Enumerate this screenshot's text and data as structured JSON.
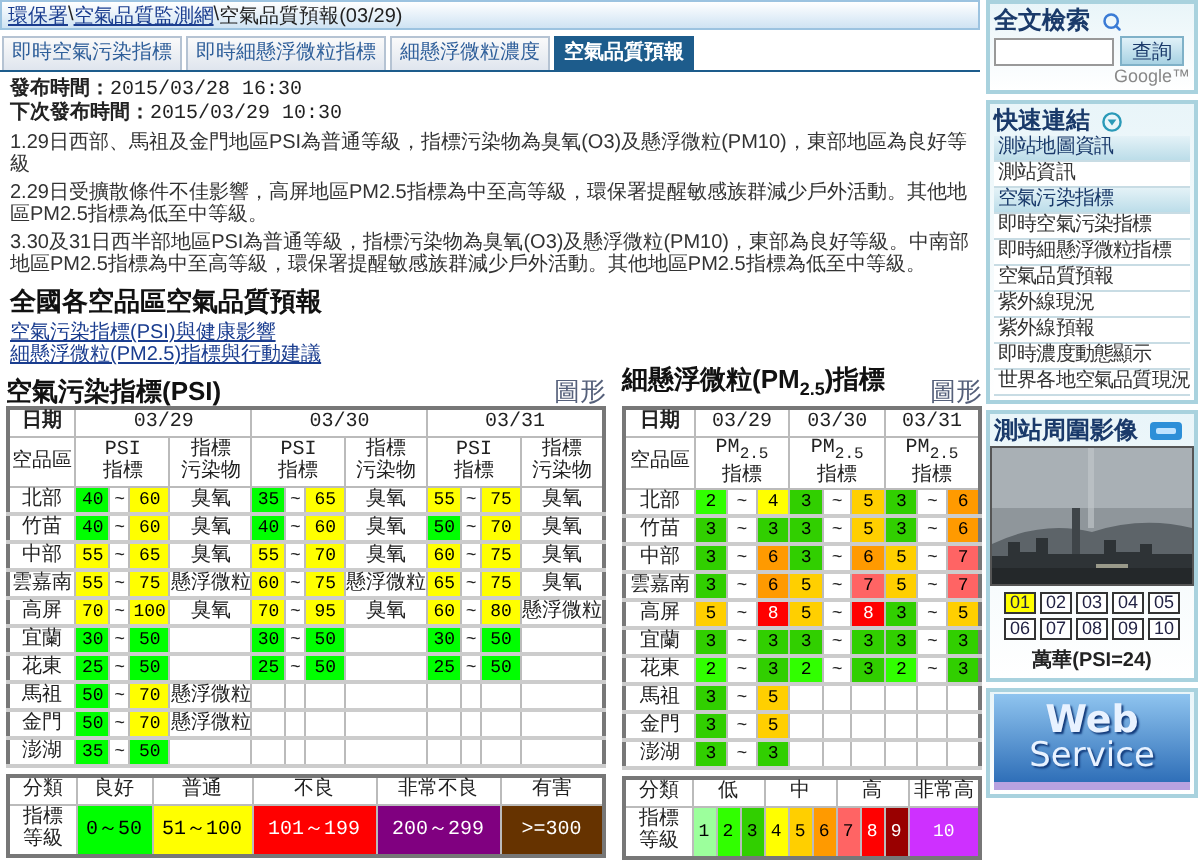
{
  "breadcrumb": [
    {
      "text": "環保署",
      "kind": "link"
    },
    {
      "text": "\\",
      "kind": "sep"
    },
    {
      "text": "空氣品質監測網",
      "kind": "link"
    },
    {
      "text": "\\",
      "kind": "sep"
    },
    {
      "text": "空氣品質預報(03/29)",
      "kind": "current"
    }
  ],
  "tabs": [
    {
      "label": "即時空氣污染指標",
      "selected": false
    },
    {
      "label": "即時細懸浮微粒指標",
      "selected": false
    },
    {
      "label": "細懸浮微粒濃度",
      "selected": false
    },
    {
      "label": "空氣品質預報",
      "selected": true
    }
  ],
  "release": [
    "**發布時間：**2015/03/28 16:30",
    "**下次發布時間：**2015/03/29 10:30"
  ],
  "paragraphs": [
    "1.29日西部、馬祖及金門地區PSI為普通等級，指標污染物為臭氧(O3)及懸浮微粒(PM10)，東部地區為良好等級",
    "2.29日受擴散條件不佳影響，高屏地區PM2.5指標為中至高等級，環保署提醒敏感族群減少戶外活動。其他地區PM2.5指標為低至中等級。",
    "3.30及31日西半部地區PSI為普通等級，指標污染物為臭氧(O3)及懸浮微粒(PM10)，東部為良好等級。中南部地區PM2.5指標為中至高等級，環保署提醒敏感族群減少戶外活動。其他地區PM2.5指標為低至中等級。"
  ],
  "heading": "全國各空品區空氣品質預報",
  "links": [
    "空氣污染指標(PSI)與健康影響",
    "細懸浮微粒(PM2.5)指標與行動建議"
  ],
  "psi": {
    "title": "空氣污染指標(PSI)",
    "graph_link": "圖形",
    "date_label": "日期",
    "area_label": "空品區",
    "days": [
      {
        "date": "03/29",
        "index_label": [
          "PSI",
          "指標"
        ],
        "pollutant_label": [
          "指標",
          "污染物"
        ]
      },
      {
        "date": "03/30",
        "index_label": [
          "PSI",
          "指標"
        ],
        "pollutant_label": [
          "指標",
          "污染物"
        ]
      },
      {
        "date": "03/31",
        "index_label": [
          "PSI",
          "指標"
        ],
        "pollutant_label": [
          "指標",
          "污染物"
        ]
      }
    ],
    "rows": [
      {
        "area": "北部",
        "days": [
          {
            "low": {
              "v": "40",
              "color": "#00ff00"
            },
            "tilde": "~",
            "high": {
              "v": "60",
              "color": "#ffff00"
            },
            "pollutant": "臭氧"
          },
          {
            "low": {
              "v": "35",
              "color": "#00ff00"
            },
            "tilde": "~",
            "high": {
              "v": "65",
              "color": "#ffff00"
            },
            "pollutant": "臭氧"
          },
          {
            "low": {
              "v": "55",
              "color": "#ffff00"
            },
            "tilde": "~",
            "high": {
              "v": "75",
              "color": "#ffff00"
            },
            "pollutant": "臭氧"
          }
        ]
      },
      {
        "area": "竹苗",
        "days": [
          {
            "low": {
              "v": "40",
              "color": "#00ff00"
            },
            "tilde": "~",
            "high": {
              "v": "60",
              "color": "#ffff00"
            },
            "pollutant": "臭氧"
          },
          {
            "low": {
              "v": "40",
              "color": "#00ff00"
            },
            "tilde": "~",
            "high": {
              "v": "60",
              "color": "#ffff00"
            },
            "pollutant": "臭氧"
          },
          {
            "low": {
              "v": "50",
              "color": "#00ff00"
            },
            "tilde": "~",
            "high": {
              "v": "70",
              "color": "#ffff00"
            },
            "pollutant": "臭氧"
          }
        ]
      },
      {
        "area": "中部",
        "days": [
          {
            "low": {
              "v": "55",
              "color": "#ffff00"
            },
            "tilde": "~",
            "high": {
              "v": "65",
              "color": "#ffff00"
            },
            "pollutant": "臭氧"
          },
          {
            "low": {
              "v": "55",
              "color": "#ffff00"
            },
            "tilde": "~",
            "high": {
              "v": "70",
              "color": "#ffff00"
            },
            "pollutant": "臭氧"
          },
          {
            "low": {
              "v": "60",
              "color": "#ffff00"
            },
            "tilde": "~",
            "high": {
              "v": "75",
              "color": "#ffff00"
            },
            "pollutant": "臭氧"
          }
        ]
      },
      {
        "area": "雲嘉南",
        "days": [
          {
            "low": {
              "v": "55",
              "color": "#ffff00"
            },
            "tilde": "~",
            "high": {
              "v": "75",
              "color": "#ffff00"
            },
            "pollutant": "懸浮微粒"
          },
          {
            "low": {
              "v": "60",
              "color": "#ffff00"
            },
            "tilde": "~",
            "high": {
              "v": "75",
              "color": "#ffff00"
            },
            "pollutant": "懸浮微粒"
          },
          {
            "low": {
              "v": "65",
              "color": "#ffff00"
            },
            "tilde": "~",
            "high": {
              "v": "75",
              "color": "#ffff00"
            },
            "pollutant": "臭氧"
          }
        ]
      },
      {
        "area": "高屏",
        "days": [
          {
            "low": {
              "v": "70",
              "color": "#ffff00"
            },
            "tilde": "~",
            "high": {
              "v": "100",
              "color": "#ffff00"
            },
            "pollutant": "臭氧"
          },
          {
            "low": {
              "v": "70",
              "color": "#ffff00"
            },
            "tilde": "~",
            "high": {
              "v": "95",
              "color": "#ffff00"
            },
            "pollutant": "臭氧"
          },
          {
            "low": {
              "v": "60",
              "color": "#ffff00"
            },
            "tilde": "~",
            "high": {
              "v": "80",
              "color": "#ffff00"
            },
            "pollutant": "懸浮微粒"
          }
        ]
      },
      {
        "area": "宜蘭",
        "days": [
          {
            "low": {
              "v": "30",
              "color": "#00ff00"
            },
            "tilde": "~",
            "high": {
              "v": "50",
              "color": "#00ff00"
            }
          },
          {
            "low": {
              "v": "30",
              "color": "#00ff00"
            },
            "tilde": "~",
            "high": {
              "v": "50",
              "color": "#00ff00"
            }
          },
          {
            "low": {
              "v": "30",
              "color": "#00ff00"
            },
            "tilde": "~",
            "high": {
              "v": "50",
              "color": "#00ff00"
            }
          }
        ]
      },
      {
        "area": "花東",
        "days": [
          {
            "low": {
              "v": "25",
              "color": "#00ff00"
            },
            "tilde": "~",
            "high": {
              "v": "50",
              "color": "#00ff00"
            }
          },
          {
            "low": {
              "v": "25",
              "color": "#00ff00"
            },
            "tilde": "~",
            "high": {
              "v": "50",
              "color": "#00ff00"
            }
          },
          {
            "low": {
              "v": "25",
              "color": "#00ff00"
            },
            "tilde": "~",
            "high": {
              "v": "50",
              "color": "#00ff00"
            }
          }
        ]
      },
      {
        "area": "馬祖",
        "days": [
          {
            "low": {
              "v": "50",
              "color": "#00ff00"
            },
            "tilde": "~",
            "high": {
              "v": "70",
              "color": "#ffff00"
            },
            "pollutant": "懸浮微粒"
          }
        ]
      },
      {
        "area": "金門",
        "days": [
          {
            "low": {
              "v": "50",
              "color": "#00ff00"
            },
            "tilde": "~",
            "high": {
              "v": "70",
              "color": "#ffff00"
            },
            "pollutant": "懸浮微粒"
          }
        ]
      },
      {
        "area": "澎湖",
        "days": [
          {
            "low": {
              "v": "35",
              "color": "#00ff00"
            },
            "tilde": "~",
            "high": {
              "v": "50",
              "color": "#00ff00"
            }
          }
        ]
      }
    ],
    "legend": {
      "category_label": "分類",
      "level_label": [
        "指標",
        "等級"
      ],
      "categories": [
        {
          "name": "良好",
          "range": "0～50",
          "color": "#00ff00"
        },
        {
          "name": "普通",
          "range": "51～100",
          "color": "#ffff00"
        },
        {
          "name": "不良",
          "range": "101～199",
          "color": "#ff0000"
        },
        {
          "name": "非常不良",
          "range": "200～299",
          "color": "#800080"
        },
        {
          "name": "有害",
          "range": ">=300",
          "color": "#663300"
        }
      ]
    }
  },
  "pm25": {
    "title": "細懸浮微粒(PM$_{2.5}$)指標",
    "graph_link": "圖形",
    "date_label": "日期",
    "area_label": "空品區",
    "days": [
      {
        "date": "03/29",
        "index_label": [
          "PM$_{2.5}$",
          "指標"
        ]
      },
      {
        "date": "03/30",
        "index_label": [
          "PM$_{2.5}$",
          "指標"
        ]
      },
      {
        "date": "03/31",
        "index_label": [
          "PM$_{2.5}$",
          "指標"
        ]
      }
    ],
    "rows": [
      {
        "area": "北部",
        "days": [
          {
            "low": {
              "v": "2",
              "color": "#31ff00"
            },
            "tilde": "~",
            "high": {
              "v": "4",
              "color": "#ffff00"
            }
          },
          {
            "low": {
              "v": "3",
              "color": "#31cf00"
            },
            "tilde": "~",
            "high": {
              "v": "5",
              "color": "#ffcf00"
            }
          },
          {
            "low": {
              "v": "3",
              "color": "#31cf00"
            },
            "tilde": "~",
            "high": {
              "v": "6",
              "color": "#ff9a00"
            }
          }
        ]
      },
      {
        "area": "竹苗",
        "days": [
          {
            "low": {
              "v": "3",
              "color": "#31cf00"
            },
            "tilde": "~",
            "high": {
              "v": "3",
              "color": "#31cf00"
            }
          },
          {
            "low": {
              "v": "3",
              "color": "#31cf00"
            },
            "tilde": "~",
            "high": {
              "v": "5",
              "color": "#ffcf00"
            }
          },
          {
            "low": {
              "v": "3",
              "color": "#31cf00"
            },
            "tilde": "~",
            "high": {
              "v": "6",
              "color": "#ff9a00"
            }
          }
        ]
      },
      {
        "area": "中部",
        "days": [
          {
            "low": {
              "v": "3",
              "color": "#31cf00"
            },
            "tilde": "~",
            "high": {
              "v": "6",
              "color": "#ff9a00"
            }
          },
          {
            "low": {
              "v": "3",
              "color": "#31cf00"
            },
            "tilde": "~",
            "high": {
              "v": "6",
              "color": "#ff9a00"
            }
          },
          {
            "low": {
              "v": "5",
              "color": "#ffcf00"
            },
            "tilde": "~",
            "high": {
              "v": "7",
              "color": "#ff6464"
            }
          }
        ]
      },
      {
        "area": "雲嘉南",
        "days": [
          {
            "low": {
              "v": "3",
              "color": "#31cf00"
            },
            "tilde": "~",
            "high": {
              "v": "6",
              "color": "#ff9a00"
            }
          },
          {
            "low": {
              "v": "5",
              "color": "#ffcf00"
            },
            "tilde": "~",
            "high": {
              "v": "7",
              "color": "#ff6464"
            }
          },
          {
            "low": {
              "v": "5",
              "color": "#ffcf00"
            },
            "tilde": "~",
            "high": {
              "v": "7",
              "color": "#ff6464"
            }
          }
        ]
      },
      {
        "area": "高屏",
        "days": [
          {
            "low": {
              "v": "5",
              "color": "#ffcf00"
            },
            "tilde": "~",
            "high": {
              "v": "8",
              "color": "#ff0000"
            }
          },
          {
            "low": {
              "v": "5",
              "color": "#ffcf00"
            },
            "tilde": "~",
            "high": {
              "v": "8",
              "color": "#ff0000"
            }
          },
          {
            "low": {
              "v": "3",
              "color": "#31cf00"
            },
            "tilde": "~",
            "high": {
              "v": "5",
              "color": "#ffcf00"
            }
          }
        ]
      },
      {
        "area": "宜蘭",
        "days": [
          {
            "low": {
              "v": "3",
              "color": "#31cf00"
            },
            "tilde": "~",
            "high": {
              "v": "3",
              "color": "#31cf00"
            }
          },
          {
            "low": {
              "v": "3",
              "color": "#31cf00"
            },
            "tilde": "~",
            "high": {
              "v": "3",
              "color": "#31cf00"
            }
          },
          {
            "low": {
              "v": "3",
              "color": "#31cf00"
            },
            "tilde": "~",
            "high": {
              "v": "3",
              "color": "#31cf00"
            }
          }
        ]
      },
      {
        "area": "花東",
        "days": [
          {
            "low": {
              "v": "2",
              "color": "#31ff00"
            },
            "tilde": "~",
            "high": {
              "v": "3",
              "color": "#31cf00"
            }
          },
          {
            "low": {
              "v": "2",
              "color": "#31ff00"
            },
            "tilde": "~",
            "high": {
              "v": "3",
              "color": "#31cf00"
            }
          },
          {
            "low": {
              "v": "2",
              "color": "#31ff00"
            },
            "tilde": "~",
            "high": {
              "v": "3",
              "color": "#31cf00"
            }
          }
        ]
      },
      {
        "area": "馬祖",
        "days": [
          {
            "low": {
              "v": "3",
              "color": "#31cf00"
            },
            "tilde": "~",
            "high": {
              "v": "5",
              "color": "#ffcf00"
            }
          }
        ]
      },
      {
        "area": "金門",
        "days": [
          {
            "low": {
              "v": "3",
              "color": "#31cf00"
            },
            "tilde": "~",
            "high": {
              "v": "5",
              "color": "#ffcf00"
            }
          }
        ]
      },
      {
        "area": "澎湖",
        "days": [
          {
            "low": {
              "v": "3",
              "color": "#31cf00"
            },
            "tilde": "~",
            "high": {
              "v": "3",
              "color": "#31cf00"
            }
          }
        ]
      }
    ],
    "legend": {
      "category_label": "分類",
      "level_label": [
        "指標",
        "等級"
      ],
      "categories": [
        {
          "name": "低",
          "levels": [
            {
              "v": "1",
              "color": "#9cff9c"
            },
            {
              "v": "2",
              "color": "#31ff00"
            },
            {
              "v": "3",
              "color": "#31cf00"
            }
          ]
        },
        {
          "name": "中",
          "levels": [
            {
              "v": "4",
              "color": "#ffff00"
            },
            {
              "v": "5",
              "color": "#ffcf00"
            },
            {
              "v": "6",
              "color": "#ff9a00"
            }
          ]
        },
        {
          "name": "高",
          "levels": [
            {
              "v": "7",
              "color": "#ff6464"
            },
            {
              "v": "8",
              "color": "#ff0000"
            },
            {
              "v": "9",
              "color": "#990000"
            }
          ]
        },
        {
          "name": "非常高",
          "levels": [
            {
              "v": "10",
              "color": "#ce30ff"
            }
          ]
        }
      ]
    }
  },
  "sidebar": {
    "search": {
      "title": "全文檢索",
      "button": "查詢",
      "powered_by": "Google™"
    },
    "quick_links": {
      "title": "快速連結",
      "items": [
        {
          "text": "測站地圖資訊",
          "kind": "section"
        },
        {
          "text": "測站資訊",
          "kind": "link"
        },
        {
          "text": "空氣污染指標",
          "kind": "section"
        },
        {
          "text": "即時空氣污染指標",
          "kind": "link"
        },
        {
          "text": "即時細懸浮微粒指標",
          "kind": "link"
        },
        {
          "text": "空氣品質預報",
          "kind": "link"
        },
        {
          "text": "紫外線現況",
          "kind": "link"
        },
        {
          "text": "紫外線預報",
          "kind": "link"
        },
        {
          "text": "即時濃度動態顯示",
          "kind": "link"
        },
        {
          "text": "世界各地空氣品質現況",
          "kind": "link"
        }
      ]
    },
    "camera": {
      "title": "測站周圍影像",
      "stations": [
        {
          "n": "01",
          "selected": true
        },
        {
          "n": "02",
          "selected": false
        },
        {
          "n": "03",
          "selected": false
        },
        {
          "n": "04",
          "selected": false
        },
        {
          "n": "05",
          "selected": false
        },
        {
          "n": "06",
          "selected": false
        },
        {
          "n": "07",
          "selected": false
        },
        {
          "n": "08",
          "selected": false
        },
        {
          "n": "09",
          "selected": false
        },
        {
          "n": "10",
          "selected": false
        }
      ],
      "caption": "萬華(PSI=24)"
    },
    "banner": [
      "Web",
      "Service"
    ]
  }
}
